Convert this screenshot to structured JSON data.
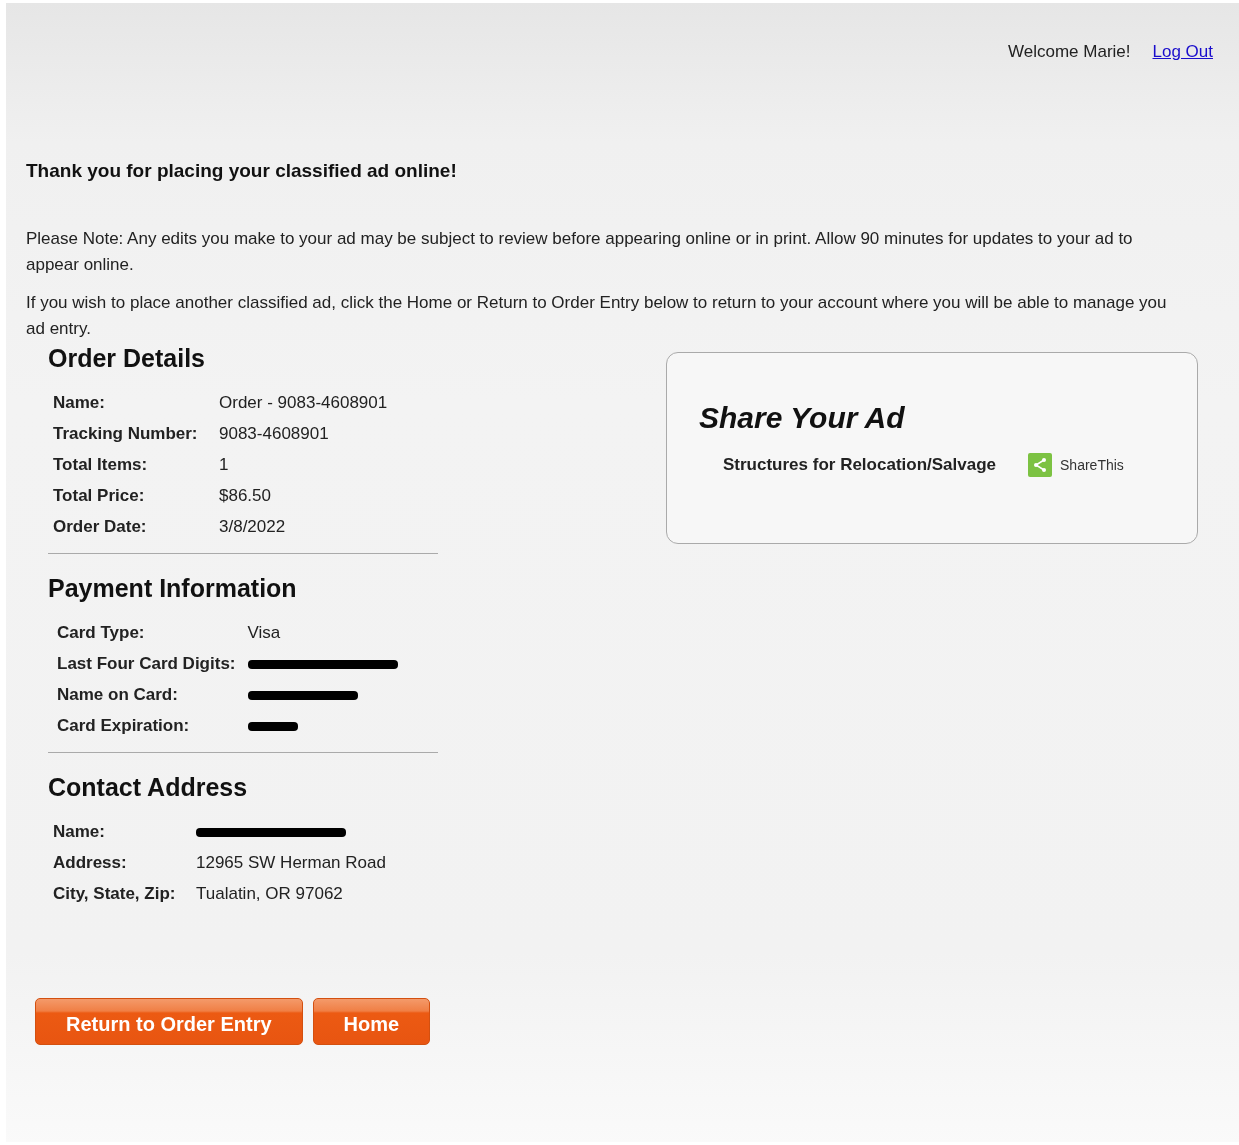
{
  "header": {
    "welcome": "Welcome Marie!",
    "logout": "Log Out"
  },
  "title": "Thank you for placing your classified ad online!",
  "notes": [
    "Please Note: Any edits you make to your ad may be subject to review before appearing online or in print. Allow 90 minutes for updates to your ad to appear online.",
    "If you wish to place another classified ad, click the Home or Return to Order Entry below to return to your account where you will be able to manage you ad entry."
  ],
  "sections": [
    {
      "heading": "Order Details",
      "rows": [
        {
          "label": "Name:",
          "value": "Order - 9083-4608901",
          "redacted": false
        },
        {
          "label": "Tracking Number:",
          "value": "9083-4608901",
          "redacted": false
        },
        {
          "label": "Total Items:",
          "value": "1",
          "redacted": false
        },
        {
          "label": "Total Price:",
          "value": "$86.50",
          "redacted": false
        },
        {
          "label": "Order Date:",
          "value": "3/8/2022",
          "redacted": false
        }
      ]
    },
    {
      "heading": "Payment Information",
      "rows": [
        {
          "label": "Card Type:",
          "value": "Visa",
          "redacted": false
        },
        {
          "label": "Last Four Card Digits:",
          "redacted": true
        },
        {
          "label": "Name on Card:",
          "redacted": true
        },
        {
          "label": "Card Expiration:",
          "redacted": true
        }
      ]
    },
    {
      "heading": "Contact Address",
      "rows": [
        {
          "label": "Name:",
          "redacted": true
        },
        {
          "label": "Address:",
          "value": "12965 SW Herman Road",
          "redacted": false
        },
        {
          "label": "City, State, Zip:",
          "value": "Tualatin, OR 97062",
          "redacted": false
        }
      ]
    }
  ],
  "share": {
    "heading": "Share Your Ad",
    "ad_title": "Structures for Relocation/Salvage",
    "share_label": "ShareThis"
  },
  "buttons": [
    "Return to Order Entry",
    "Home"
  ]
}
